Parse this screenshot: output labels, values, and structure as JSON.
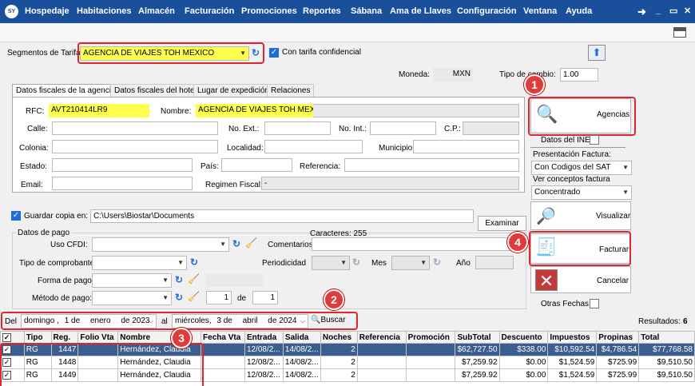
{
  "menu": {
    "logo": "SY",
    "items": [
      "Hospedaje",
      "Habitaciones",
      "Almacén",
      "Facturación",
      "Promociones",
      "Reportes",
      "Sábana",
      "Ama de Llaves",
      "Configuración",
      "Ventana",
      "Ayuda"
    ],
    "controls": [
      "_",
      "▭",
      "✕"
    ]
  },
  "segment": {
    "label": "Segmentos de Tarifa:",
    "value": "AGENCIA DE VIAJES TOH MEXICO",
    "confidential_label": "Con tarifa confidencial"
  },
  "currency": {
    "label": "Moneda:",
    "value": "MXN",
    "rate_label": "Tipo de cambio:",
    "rate_value": "1.00"
  },
  "tabs": [
    "Datos fiscales de la agencia",
    "Datos fiscales del hotel",
    "Lugar de expedición",
    "Relaciones"
  ],
  "fiscal": {
    "rfc_label": "RFC:",
    "rfc": "AVT210414LR9",
    "name_label": "Nombre:",
    "name": "AGENCIA DE VIAJES TOH MEXICO",
    "street_label": "Calle:",
    "ext_label": "No. Ext.:",
    "int_label": "No. Int.:",
    "cp_label": "C.P.:",
    "colony_label": "Colonia:",
    "locality_label": "Localidad:",
    "municipality_label": "Municipio:",
    "state_label": "Estado:",
    "country_label": "País:",
    "reference_label": "Referencia:",
    "email_label": "Email:",
    "regime_label": "Regimen Fiscal:",
    "regime": "-"
  },
  "save_copy": {
    "label": "Guardar copia en:",
    "path": "C:\\Users\\Biostar\\Documents",
    "browse": "Examinar"
  },
  "payment": {
    "group_label": "Datos de pago",
    "cfdi_label": "Uso CFDI:",
    "comments_label": "Comentarios:",
    "chars_label": "Caracteres: 255",
    "voucher_label": "Tipo de comprobante:",
    "periodicity_label": "Periodicidad",
    "month_label": "Mes",
    "year_label": "Año",
    "form_label": "Forma de pago:",
    "method_label": "Método de pago:",
    "installment": "1",
    "of_label": "de",
    "installments_total": "1"
  },
  "side": {
    "agencies": "Agencias",
    "ine_label": "Datos del INE",
    "invoice_presentation_label": "Presentación Factura:",
    "invoice_presentation": "Con Codigos del SAT",
    "concepts_label": "Ver conceptos factura",
    "concepts": "Concentrado",
    "preview": "Visualizar",
    "invoice": "Facturar",
    "cancel": "Cancelar",
    "other_dates": "Otras Fechas"
  },
  "search": {
    "from_label": "Del",
    "from_day": "domingo ,",
    "from_num": "1 de",
    "from_month": "enero",
    "from_year": "de 2023",
    "to_label": "al",
    "to_day": "miércoles,",
    "to_num": "3 de",
    "to_month": "abril",
    "to_year": "de 2024",
    "button": "Buscar",
    "results_label": "Resultados:",
    "results": "6"
  },
  "badges": [
    "1",
    "2",
    "3",
    "4"
  ],
  "table": {
    "headers": [
      "",
      "Tipo",
      "Reg.",
      "Folio Vta",
      "Nombre",
      "Fecha Vta",
      "Entrada",
      "Salida",
      "Noches",
      "Referencia",
      "Promoción",
      "SubTotal",
      "Descuento",
      "Impuestos",
      "Propinas",
      "Total"
    ],
    "rows": [
      [
        "✓",
        "RG",
        "1447",
        "",
        "Hernández, Claudia",
        "",
        "12/08/2...",
        "14/08/2...",
        "2",
        "",
        "",
        "$62,727.50",
        "$338.00",
        "$10,592.54",
        "$4,786.54",
        "$77,768.58"
      ],
      [
        "✓",
        "RG",
        "1448",
        "",
        "Hernández, Claudia",
        "",
        "12/08/2...",
        "14/08/2...",
        "2",
        "",
        "",
        "$7,259.92",
        "$0.00",
        "$1,524.59",
        "$725.99",
        "$9,510.50"
      ],
      [
        "✓",
        "RG",
        "1449",
        "",
        "Hernández, Claudia",
        "",
        "12/08/2...",
        "14/08/2...",
        "2",
        "",
        "",
        "$7,259.92",
        "$0.00",
        "$1,524.59",
        "$725.99",
        "$9,510.50"
      ]
    ]
  },
  "colors": {
    "menu_bg": "#1a4f9c",
    "highlight": "#ffff4d",
    "callout": "#e0262f",
    "selected_row": "#3b5e91"
  }
}
